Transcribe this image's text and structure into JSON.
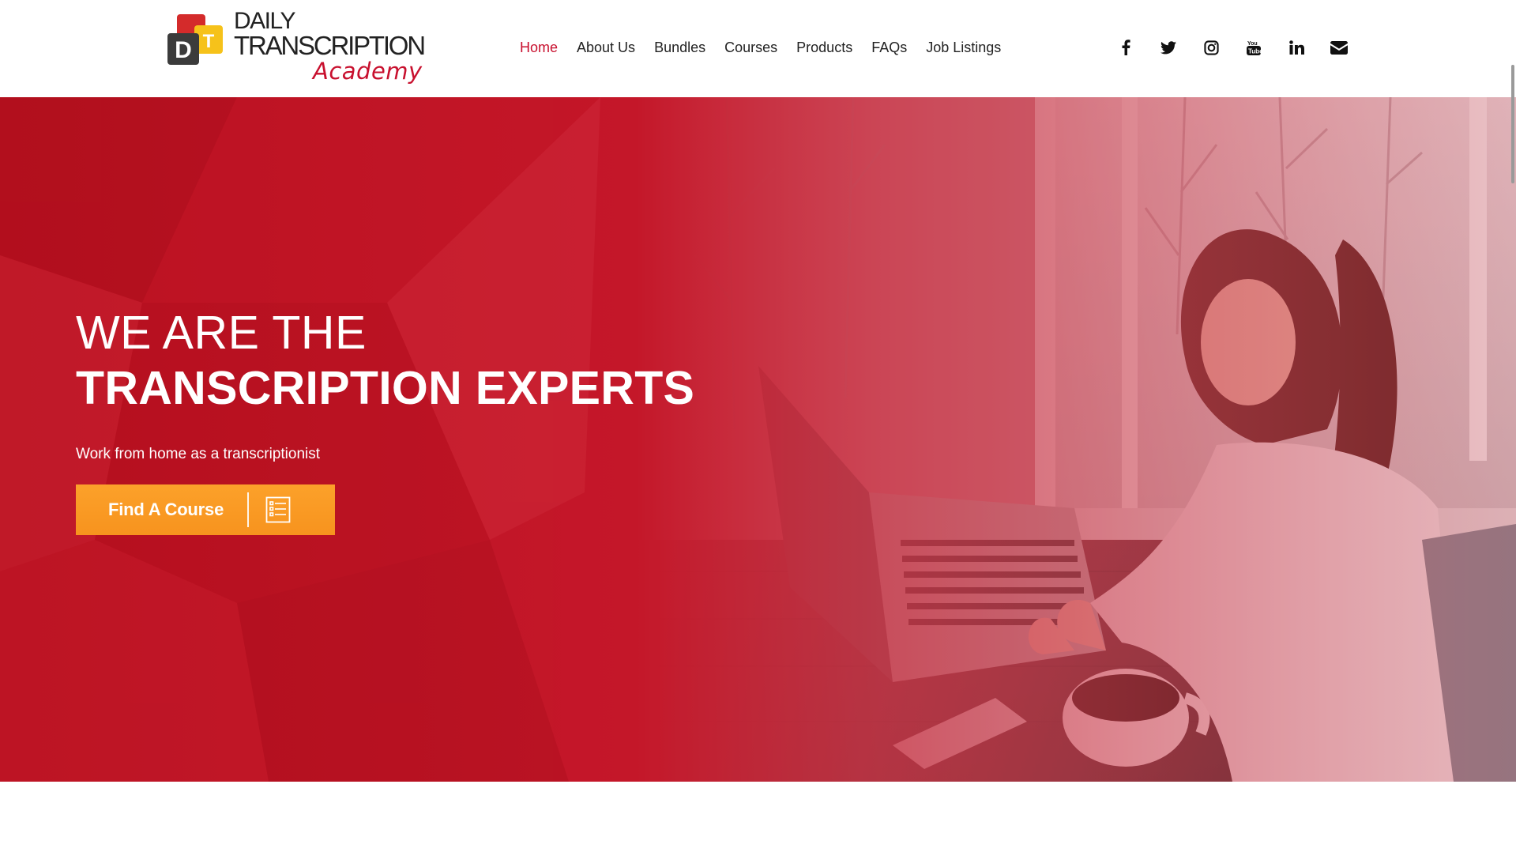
{
  "logo": {
    "line1": "DAILY",
    "line2": "TRANSCRIPTION",
    "line3": "Academy",
    "mark_letters": [
      "D",
      "T"
    ]
  },
  "nav": {
    "items": [
      {
        "label": "Home",
        "active": true
      },
      {
        "label": "About Us",
        "active": false
      },
      {
        "label": "Bundles",
        "active": false
      },
      {
        "label": "Courses",
        "active": false
      },
      {
        "label": "Products",
        "active": false
      },
      {
        "label": "FAQs",
        "active": false
      },
      {
        "label": "Job Listings",
        "active": false
      }
    ]
  },
  "social": {
    "icons": [
      "facebook-icon",
      "twitter-icon",
      "instagram-icon",
      "youtube-icon",
      "linkedin-icon",
      "email-icon"
    ]
  },
  "hero": {
    "title_line1": "WE ARE THE",
    "title_line2": "TRANSCRIPTION EXPERTS",
    "subtitle": "Work from home as a transcriptionist",
    "cta_label": "Find A Course",
    "cta_icon": "list-icon"
  },
  "colors": {
    "brand_red": "#c8102e",
    "hero_red": "#b3101f",
    "cta_orange": "#f7931e",
    "text_dark": "#222222"
  }
}
